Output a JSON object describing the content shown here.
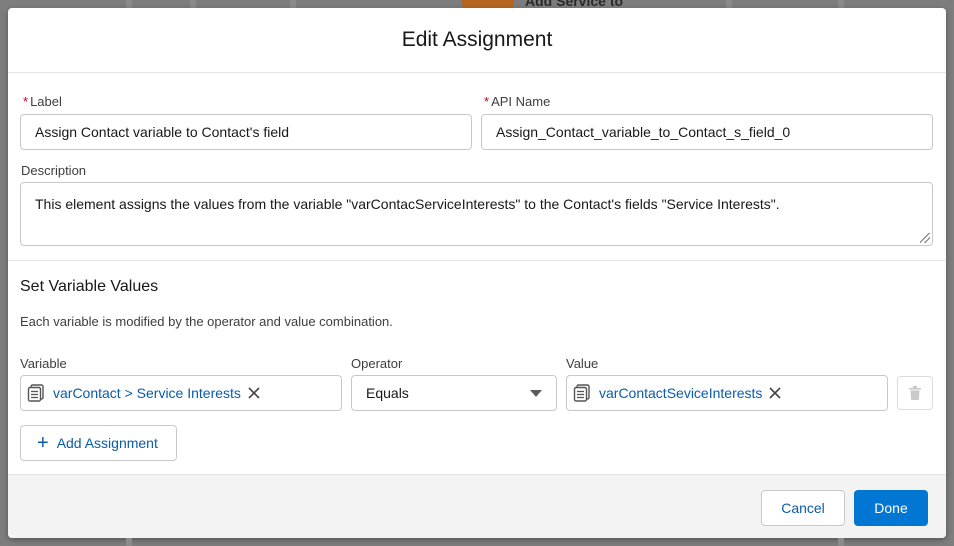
{
  "background": {
    "node_label": "Add Service to"
  },
  "modal": {
    "title": "Edit Assignment"
  },
  "label_field": {
    "label": "Label",
    "required_mark": "*",
    "value": "Assign Contact variable to Contact's field"
  },
  "api_field": {
    "label": "API Name",
    "required_mark": "*",
    "value": "Assign_Contact_variable_to_Contact_s_field_0"
  },
  "description_field": {
    "label": "Description",
    "value": "This element assigns the values from the variable \"varContacServiceInterests\" to the Contact's fields \"Service Interests\"."
  },
  "variables_section": {
    "title": "Set Variable Values",
    "helper": "Each variable is modified by the operator and value combination.",
    "col_variable": "Variable",
    "col_operator": "Operator",
    "col_value": "Value",
    "row": {
      "variable": "varContact > Service Interests",
      "operator": "Equals",
      "value": "varContactSeviceInterests"
    },
    "add_label": "Add Assignment"
  },
  "footer": {
    "cancel": "Cancel",
    "done": "Done"
  },
  "colors": {
    "brand": "#0176d3",
    "link": "#0b5cab",
    "required": "#ba0517"
  }
}
